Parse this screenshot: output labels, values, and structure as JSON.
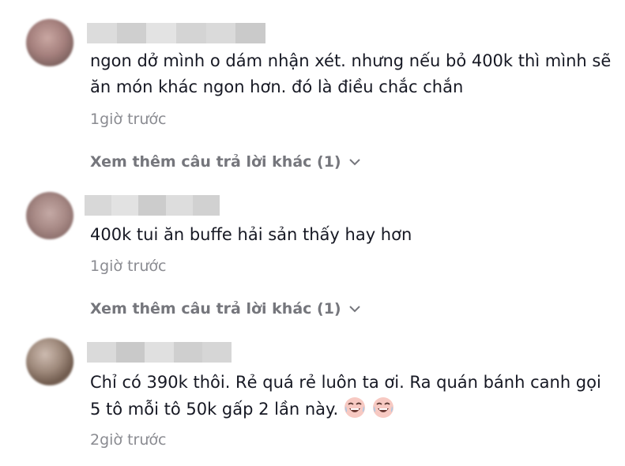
{
  "comments": [
    {
      "text": "ngon dở mình o dám nhận xét. nhưng nếu bỏ 400k thì mình sẽ ăn món khác ngon hơn. đó là điều chắc chắn",
      "time": "1giờ trước",
      "replies_label": "Xem thêm câu trả lời khác (1)"
    },
    {
      "text": "400k tui ăn buffe hải sản thấy hay hơn",
      "time": "1giờ trước",
      "replies_label": "Xem thêm câu trả lời khác (1)"
    },
    {
      "text": "Chỉ có 390k thôi. Rẻ quá rẻ luôn ta ơi. Ra quán bánh canh gọi 5 tô mỗi tô 50k gấp 2 lần này.",
      "time": "2giờ trước",
      "emoji": [
        "laughing-crying-emoji",
        "laughing-crying-emoji"
      ]
    }
  ],
  "colors": {
    "text": "#161823",
    "muted": "#8a8b91",
    "replies": "#75767c"
  }
}
